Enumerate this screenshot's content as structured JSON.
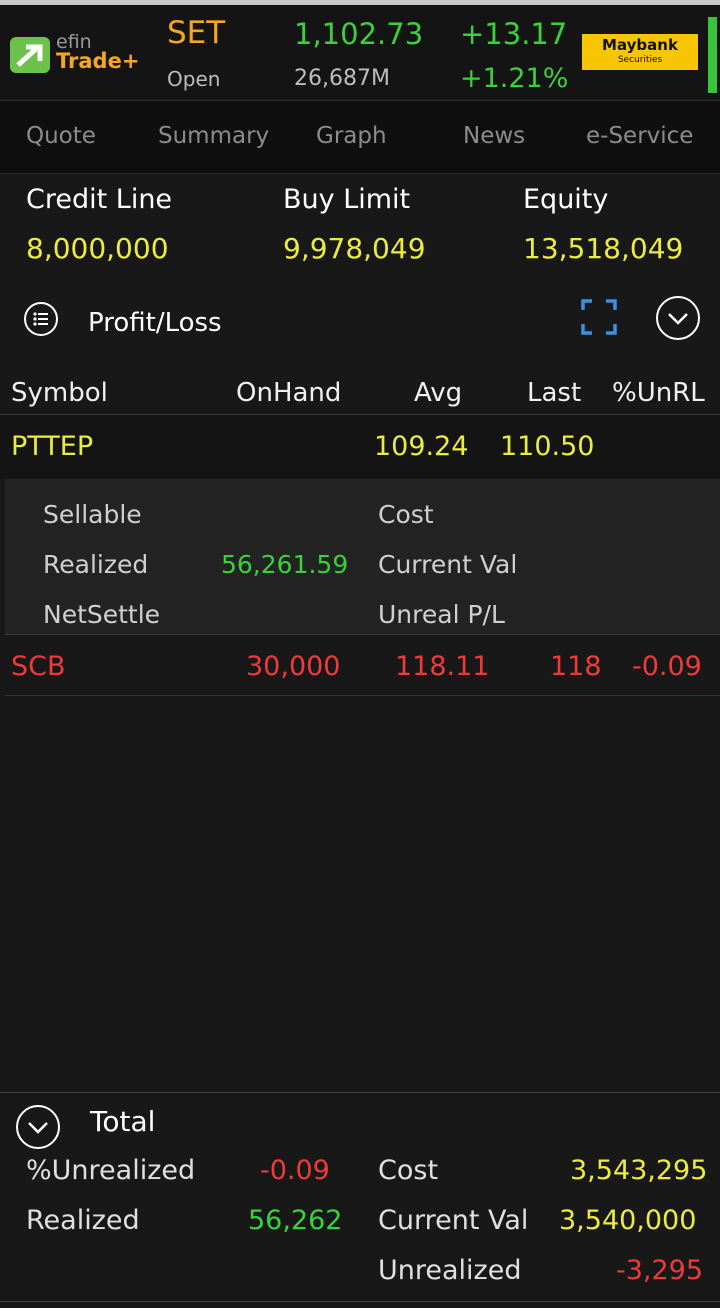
{
  "colors": {
    "gain": "#3ad13a",
    "loss": "#f03a3a",
    "neutral": "#ecec3e",
    "accent": "#f6a623",
    "brand": "#f7c600"
  },
  "header": {
    "logo_top": "efin",
    "logo_bottom": "Trade+",
    "market": "SET",
    "status": "Open",
    "index_value": "1,102.73",
    "volume": "26,687M",
    "change": "+13.17",
    "change_pct": "+1.21%",
    "broker_name": "Maybank",
    "broker_sub": "Securities"
  },
  "tabs": [
    "Quote",
    "Summary",
    "Graph",
    "News",
    "e-Service"
  ],
  "account": {
    "credit_line_label": "Credit Line",
    "credit_line": "8,000,000",
    "buy_limit_label": "Buy Limit",
    "buy_limit": "9,978,049",
    "equity_label": "Equity",
    "equity": "13,518,049"
  },
  "portfolio": {
    "title": "Profit/Loss",
    "columns": [
      "Symbol",
      "OnHand",
      "Avg",
      "Last",
      "%UnRL"
    ],
    "rows": [
      {
        "symbol": "PTTEP",
        "onhand": "",
        "avg": "109.24",
        "last": "110.50",
        "unrl": ""
      },
      {
        "symbol": "SCB",
        "onhand": "30,000",
        "avg": "118.11",
        "last": "118",
        "unrl": "-0.09"
      }
    ],
    "detail": {
      "sellable_label": "Sellable",
      "sellable": "",
      "realized_label": "Realized",
      "realized": "56,261.59",
      "netsettle_label": "NetSettle",
      "netsettle": "",
      "cost_label": "Cost",
      "cost": "",
      "current_val_label": "Current Val",
      "current_val": "",
      "unreal_label": "Unreal P/L",
      "unreal": ""
    }
  },
  "total": {
    "title": "Total",
    "unrealized_pct_label": "%Unrealized",
    "unrealized_pct": "-0.09",
    "realized_label": "Realized",
    "realized": "56,262",
    "cost_label": "Cost",
    "cost": "3,543,295",
    "current_val_label": "Current Val",
    "current_val": "3,540,000",
    "unrealized_label": "Unrealized",
    "unrealized": "-3,295"
  }
}
